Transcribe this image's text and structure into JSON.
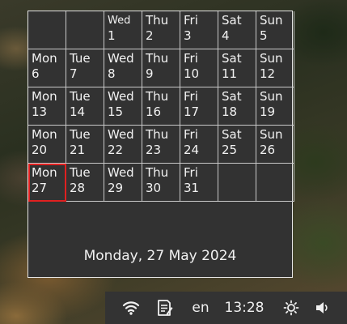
{
  "calendar": {
    "rows": [
      [
        {
          "day": "",
          "num": "",
          "type": "empty"
        },
        {
          "day": "",
          "num": "",
          "type": "empty"
        },
        {
          "day": "Wed",
          "num": "1",
          "small": true
        },
        {
          "day": "Thu",
          "num": "2"
        },
        {
          "day": "Fri",
          "num": "3"
        },
        {
          "day": "Sat",
          "num": "4"
        },
        {
          "day": "Sun",
          "num": "5"
        }
      ],
      [
        {
          "day": "Mon",
          "num": "6"
        },
        {
          "day": "Tue",
          "num": "7"
        },
        {
          "day": "Wed",
          "num": "8"
        },
        {
          "day": "Thu",
          "num": "9"
        },
        {
          "day": "Fri",
          "num": "10"
        },
        {
          "day": "Sat",
          "num": "11"
        },
        {
          "day": "Sun",
          "num": "12"
        }
      ],
      [
        {
          "day": "Mon",
          "num": "13"
        },
        {
          "day": "Tue",
          "num": "14"
        },
        {
          "day": "Wed",
          "num": "15"
        },
        {
          "day": "Thu",
          "num": "16"
        },
        {
          "day": "Fri",
          "num": "17"
        },
        {
          "day": "Sat",
          "num": "18"
        },
        {
          "day": "Sun",
          "num": "19"
        }
      ],
      [
        {
          "day": "Mon",
          "num": "20"
        },
        {
          "day": "Tue",
          "num": "21"
        },
        {
          "day": "Wed",
          "num": "22"
        },
        {
          "day": "Thu",
          "num": "23"
        },
        {
          "day": "Fri",
          "num": "24"
        },
        {
          "day": "Sat",
          "num": "25"
        },
        {
          "day": "Sun",
          "num": "26"
        }
      ],
      [
        {
          "day": "Mon",
          "num": "27",
          "today": true
        },
        {
          "day": "Tue",
          "num": "28"
        },
        {
          "day": "Wed",
          "num": "29"
        },
        {
          "day": "Thu",
          "num": "30"
        },
        {
          "day": "Fri",
          "num": "31"
        },
        {
          "day": "",
          "num": "",
          "type": "empty"
        },
        {
          "day": "",
          "num": "",
          "type": "empty"
        }
      ]
    ],
    "full_date": "Monday, 27 May 2024",
    "today_color": "#e02020"
  },
  "taskbar": {
    "wifi_icon": "wifi-icon",
    "notes_icon": "notes-icon",
    "language": "en",
    "time": "13:28",
    "brightness_icon": "brightness-icon",
    "volume_icon": "volume-icon"
  }
}
